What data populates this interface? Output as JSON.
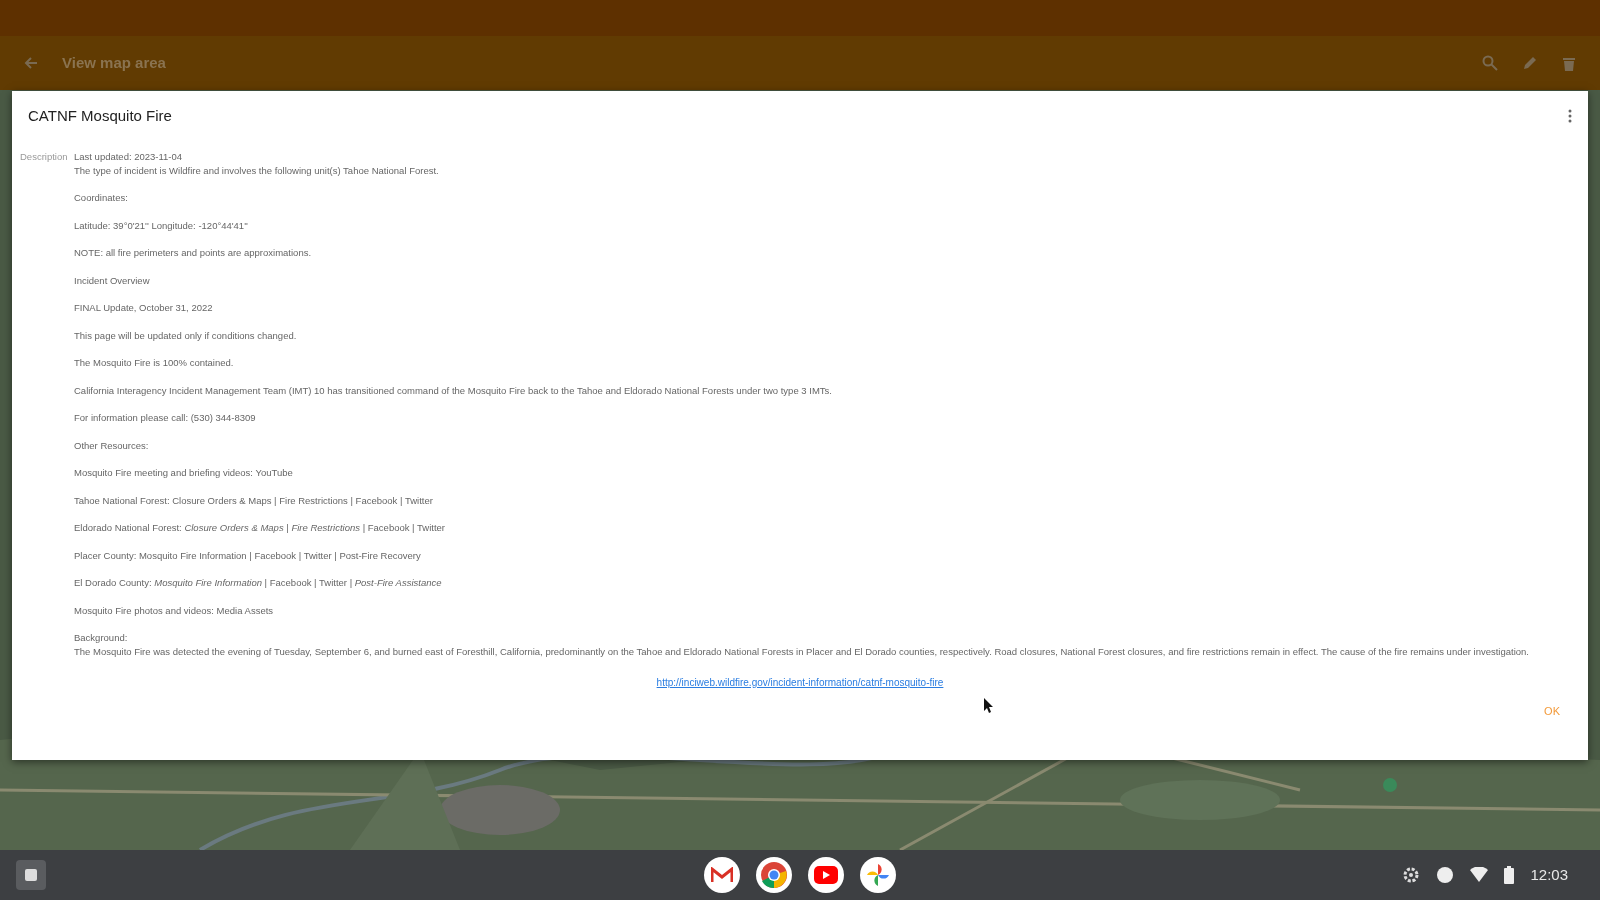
{
  "app_bar": {
    "title": "View map area"
  },
  "dialog": {
    "title": "CATNF Mosquito Fire",
    "description_label": "Description",
    "paragraphs": [
      {
        "lines": [
          "Last updated: 2023-11-04",
          "The type of incident is Wildfire and involves the following unit(s) Tahoe National Forest."
        ]
      },
      {
        "lines": [
          "Coordinates:"
        ]
      },
      {
        "lines": [
          "Latitude: 39°0'21'' Longitude: -120°44'41''"
        ]
      },
      {
        "lines": [
          "NOTE: all fire perimeters and points are approximations."
        ]
      },
      {
        "lines": [
          "Incident Overview"
        ]
      },
      {
        "lines": [
          "FINAL Update, October 31, 2022"
        ]
      },
      {
        "lines": [
          "This page will be updated only if conditions changed."
        ]
      },
      {
        "lines": [
          "The Mosquito Fire is 100% contained."
        ]
      },
      {
        "lines": [
          "California Interagency Incident Management Team (IMT) 10 has transitioned command of the Mosquito Fire back to the Tahoe and Eldorado National Forests under two type 3 IMTs."
        ]
      },
      {
        "lines": [
          "For information please call: (530) 344-8309"
        ]
      },
      {
        "lines": [
          "Other Resources:"
        ]
      },
      {
        "lines": [
          "Mosquito Fire meeting and briefing videos: YouTube"
        ]
      },
      {
        "lines": [
          "Tahoe National Forest: Closure Orders & Maps | Fire Restrictions | Facebook | Twitter"
        ]
      },
      {
        "lines": [
          "Eldorado National Forest: *Closure Orders & Maps* | *Fire Restrictions* | Facebook | Twitter"
        ]
      },
      {
        "lines": [
          "Placer County: Mosquito Fire Information | Facebook | Twitter | Post-Fire Recovery"
        ]
      },
      {
        "lines": [
          "El Dorado County: *Mosquito Fire Information* | Facebook | Twitter | *Post-Fire Assistance*"
        ]
      },
      {
        "lines": [
          "Mosquito Fire photos and videos: Media Assets"
        ]
      },
      {
        "lines": [
          "Background:",
          "The Mosquito Fire was detected the evening of Tuesday, September 6, and burned east of Foresthill, California, predominantly on the Tahoe and Eldorado National Forests in Placer and El Dorado counties, respectively. Road closures, National Forest closures, and fire restrictions remain in effect. The cause of the fire remains under investigation."
        ]
      }
    ],
    "link": "http://inciweb.wildfire.gov/incident-information/catnf-mosquito-fire",
    "ok_button": "OK"
  },
  "shelf": {
    "time": "12:03"
  }
}
